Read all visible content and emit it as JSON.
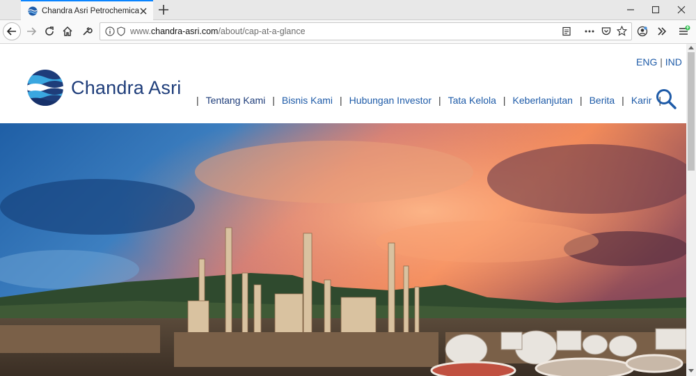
{
  "browser": {
    "tab_title": "Chandra Asri Petrochemical",
    "url_prefix": "www.",
    "url_domain": "chandra-asri.com",
    "url_path": "/about/cap-at-a-glance"
  },
  "site": {
    "brand": "Chandra Asri",
    "lang_eng": "ENG",
    "lang_sep": "|",
    "lang_ind": "IND",
    "nav": [
      {
        "label": "Tentang Kami"
      },
      {
        "label": "Bisnis Kami"
      },
      {
        "label": "Hubungan Investor"
      },
      {
        "label": "Tata Kelola"
      },
      {
        "label": "Keberlanjutan"
      },
      {
        "label": "Berita"
      },
      {
        "label": "Karir"
      }
    ],
    "nav_sep": "|"
  },
  "colors": {
    "brand_blue": "#1e3d7a",
    "link_blue": "#1e5ba8",
    "tab_accent": "#0a84ff"
  },
  "icons": [
    "chandra-asri-logo-icon",
    "search-icon",
    "back-icon",
    "forward-icon",
    "reload-icon",
    "home-icon",
    "wrench-icon",
    "info-icon",
    "shield-icon",
    "reader-icon",
    "more-icon",
    "pocket-icon",
    "star-icon",
    "account-icon",
    "overflow-icon",
    "menu-icon"
  ]
}
